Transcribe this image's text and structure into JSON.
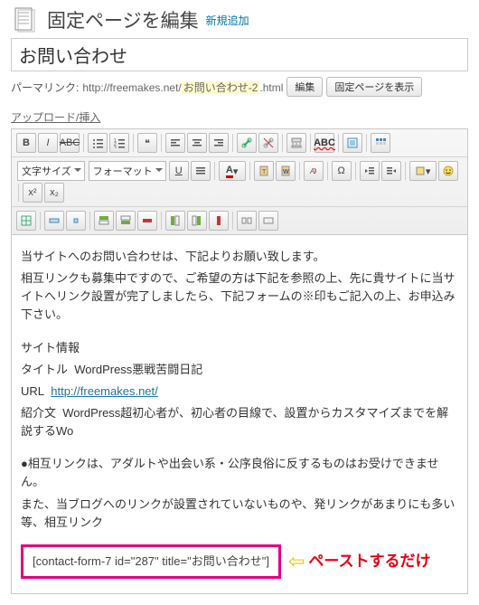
{
  "header": {
    "title": "固定ページを編集",
    "add_new": "新規追加"
  },
  "post": {
    "title": "お問い合わせ"
  },
  "permalink": {
    "label": "パーマリンク:",
    "base": "http://freemakes.net/",
    "slug": "お問い合わせ-2",
    "ext": ".html",
    "edit_btn": "編集",
    "view_btn": "固定ページを表示"
  },
  "media": {
    "upload_insert": "アップロード/挿入"
  },
  "toolbar": {
    "font_size": "文字サイズ",
    "format": "フォーマット"
  },
  "content": {
    "p1": "当サイトへのお問い合わせは、下記よりお願い致します。",
    "p2": "相互リンクも募集中ですので、ご希望の方は下記を参照の上、先に貴サイトに当サイトへリンク設置が完了しましたら、下記フォームの※印もご記入の上、お申込み下さい。",
    "h1": "サイト情報",
    "l_title_k": "タイトル",
    "l_title_v": "WordPress悪戦苦闘日記",
    "l_url_k": "URL",
    "l_url_v": "http://freemakes.net/",
    "l_intro_k": "紹介文",
    "l_intro_v": "WordPress超初心者が、初心者の目線で、設置からカスタマイズまでを解説するWo",
    "note1": "●相互リンクは、アダルトや出会い系・公序良俗に反するものはお受けできません。",
    "note2": "また、当ブログへのリンクが設置されていないものや、発リンクがあまりにも多い等、相互リンク",
    "shortcode": "[contact-form-7 id=\"287\" title=\"お問い合わせ\"]",
    "arrow_text": "ペーストするだけ"
  }
}
